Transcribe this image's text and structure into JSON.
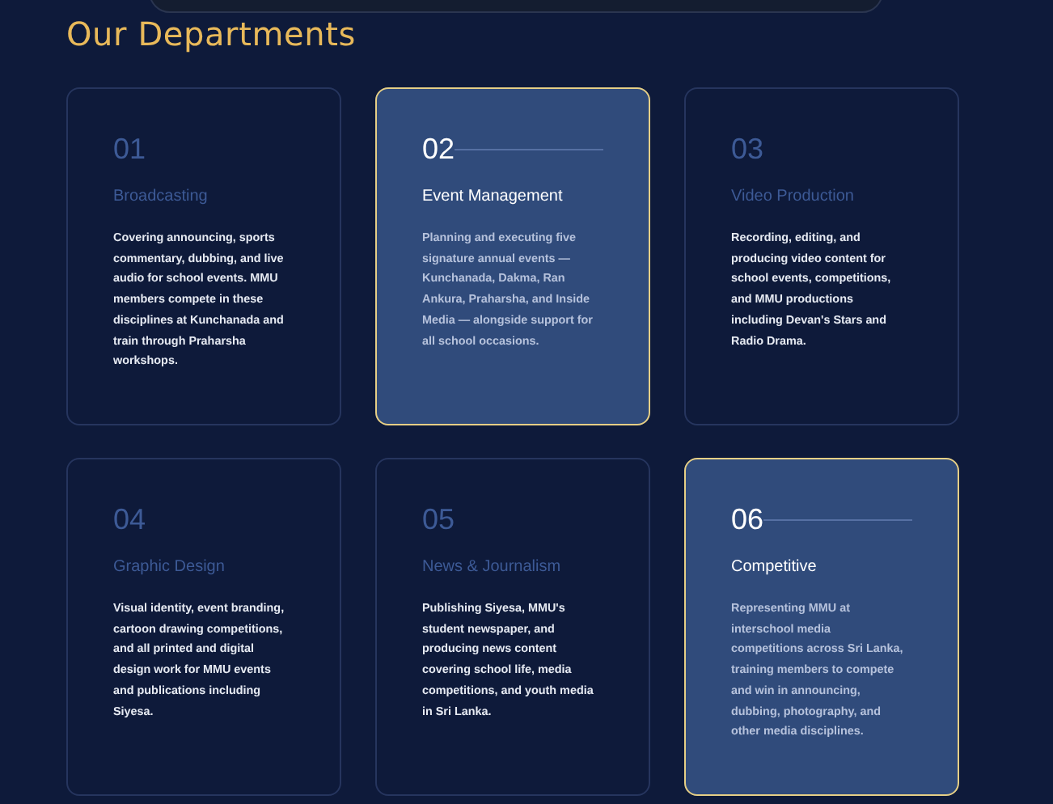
{
  "heading": "Our Departments",
  "departments": [
    {
      "number": "01",
      "title": "Broadcasting",
      "description": "Covering announcing, sports commentary, dubbing, and live audio for school events. MMU members compete in these disciplines at Kunchanada and train through Praharsha workshops.",
      "highlighted": false
    },
    {
      "number": "02",
      "title": "Event Management",
      "description": "Planning and executing five signature annual events — Kunchanada, Dakma, Ran Ankura, Praharsha, and Inside Media — alongside support for all school occasions.",
      "highlighted": true
    },
    {
      "number": "03",
      "title": "Video Production",
      "description": "Recording, editing, and producing video content for school events, competitions, and MMU productions including Devan's Stars and Radio Drama.",
      "highlighted": false
    },
    {
      "number": "04",
      "title": "Graphic Design",
      "description": "Visual identity, event branding, cartoon drawing competitions, and all printed and digital design work for MMU events and publications including Siyesa.",
      "highlighted": false
    },
    {
      "number": "05",
      "title": "News & Journalism",
      "description": "Publishing Siyesa, MMU's student newspaper, and producing news content covering school life, media competitions, and youth media in Sri Lanka.",
      "highlighted": false
    },
    {
      "number": "06",
      "title": "Competitive",
      "description": "Representing MMU at interschool media competitions across Sri Lanka, training members to compete and win in announcing, dubbing, photography, and other media disciplines.",
      "highlighted": true
    }
  ]
}
